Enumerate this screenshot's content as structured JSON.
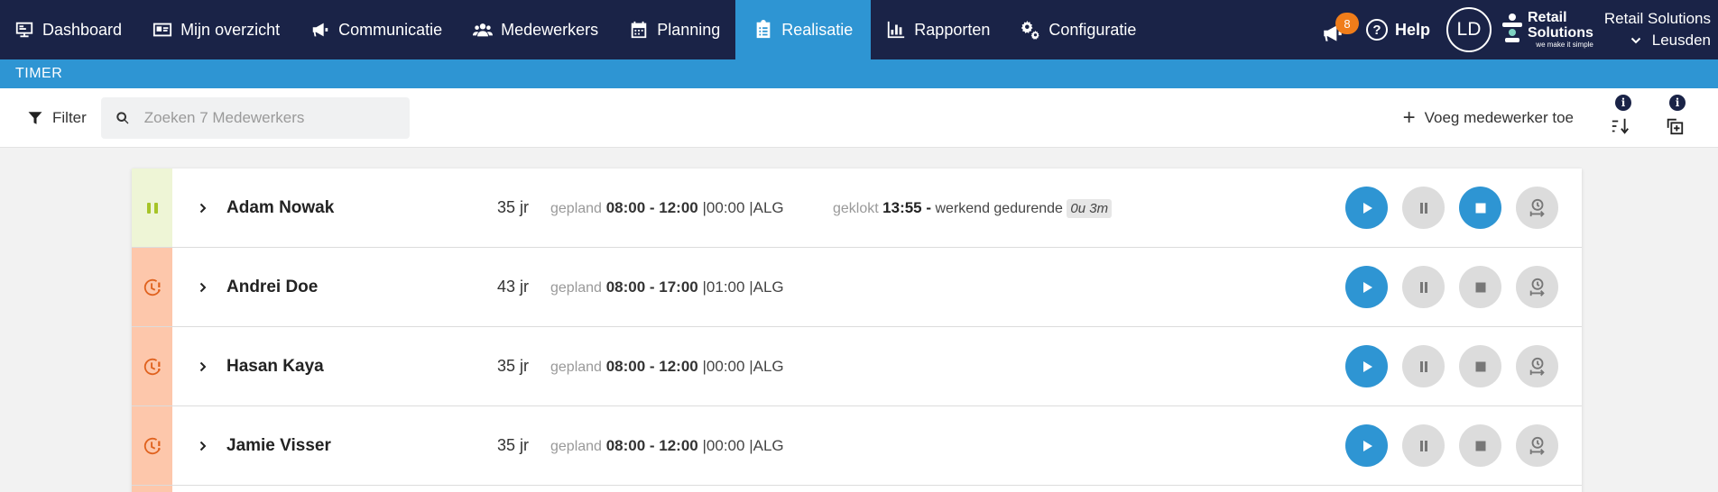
{
  "nav": {
    "items": [
      {
        "label": "Dashboard",
        "icon": "monitor-icon"
      },
      {
        "label": "Mijn overzicht",
        "icon": "id-card-icon"
      },
      {
        "label": "Communicatie",
        "icon": "megaphone-icon"
      },
      {
        "label": "Medewerkers",
        "icon": "users-icon"
      },
      {
        "label": "Planning",
        "icon": "calendar-icon"
      },
      {
        "label": "Realisatie",
        "icon": "clipboard-icon",
        "active": true
      },
      {
        "label": "Rapporten",
        "icon": "bar-chart-icon"
      },
      {
        "label": "Configuratie",
        "icon": "gears-icon"
      }
    ],
    "notification_count": "8",
    "help_label": "Help",
    "user_initials": "LD",
    "brand_line1": "Retail",
    "brand_line2": "Solutions",
    "brand_tagline": "we make it simple",
    "store_name": "Retail Solutions",
    "store_location": "Leusden"
  },
  "timer_bar": {
    "title": "TIMER"
  },
  "toolbar": {
    "filter_label": "Filter",
    "search_placeholder": "Zoeken 7 Medewerkers",
    "add_employee_label": "Voeg medewerker toe",
    "sort_icon": "sort-icon",
    "copy_icon": "copy-icon"
  },
  "labels": {
    "planned": "gepland",
    "clocked": "geklokt",
    "working_for": "werkend gedurende"
  },
  "employees": [
    {
      "name": "Adam Nowak",
      "age": "35 jr",
      "shift": "08:00 - 12:00",
      "break": "|00:00",
      "dept": "|ALG",
      "status": "paused",
      "clocked_time": "13:55 -",
      "duration": "0u 3m",
      "stop_active": true
    },
    {
      "name": "Andrei Doe",
      "age": "43 jr",
      "shift": "08:00 - 17:00",
      "break": "|01:00",
      "dept": "|ALG",
      "status": "late"
    },
    {
      "name": "Hasan Kaya",
      "age": "35 jr",
      "shift": "08:00 - 12:00",
      "break": "|00:00",
      "dept": "|ALG",
      "status": "late"
    },
    {
      "name": "Jamie Visser",
      "age": "35 jr",
      "shift": "08:00 - 12:00",
      "break": "|00:00",
      "dept": "|ALG",
      "status": "late"
    }
  ],
  "colors": {
    "nav_bg": "#1a2347",
    "accent_blue": "#2e95d3",
    "badge_orange": "#f07d1a",
    "late_bg": "#fdc7ab",
    "late_icon": "#e0621e",
    "paused_bg": "#eef5d6",
    "paused_icon": "#a6c428"
  }
}
